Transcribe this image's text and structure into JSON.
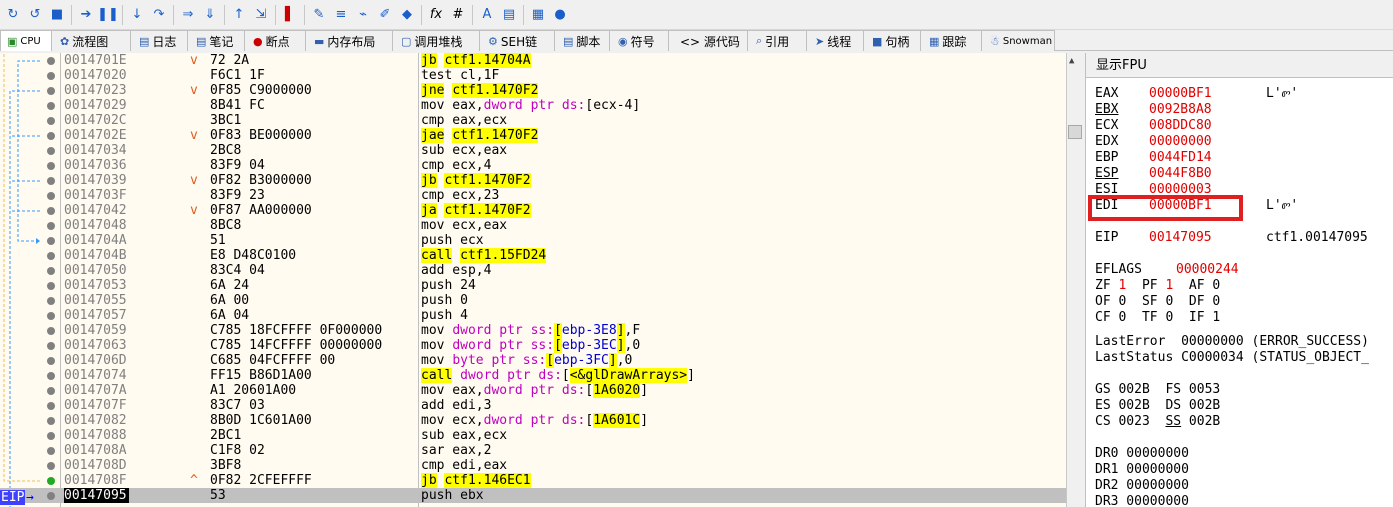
{
  "toolbar": {
    "icons": [
      "open-icon",
      "restart-icon",
      "stop-icon",
      "run-icon",
      "pause-icon",
      "step-into-icon",
      "step-over-icon",
      "trace-into-icon",
      "trace-over-icon",
      "execute-till-return-icon",
      "run-to-user-code-icon",
      "breakpoint-icon",
      "patch-icon",
      "comment-icon",
      "label-icon",
      "bookmark-icon",
      "highlight-icon",
      "fx-icon",
      "hash-icon",
      "font-icon",
      "dump-icon",
      "calculator-icon",
      "globe-icon"
    ]
  },
  "tabs": [
    {
      "label": "CPU",
      "icon": "cpu-icon"
    },
    {
      "label": "流程图",
      "icon": "graph-icon"
    },
    {
      "label": "日志",
      "icon": "log-icon"
    },
    {
      "label": "笔记",
      "icon": "notes-icon"
    },
    {
      "label": "断点",
      "icon": "breakpoint-dot-icon"
    },
    {
      "label": "内存布局",
      "icon": "memory-icon"
    },
    {
      "label": "调用堆栈",
      "icon": "callstack-icon"
    },
    {
      "label": "SEH链",
      "icon": "seh-icon"
    },
    {
      "label": "脚本",
      "icon": "script-icon"
    },
    {
      "label": "符号",
      "icon": "symbol-icon"
    },
    {
      "label": "<> 源代码",
      "icon": "source-icon"
    },
    {
      "label": "引用",
      "icon": "search-icon"
    },
    {
      "label": "线程",
      "icon": "thread-icon"
    },
    {
      "label": "句柄",
      "icon": "handle-icon"
    },
    {
      "label": "跟踪",
      "icon": "trace-icon"
    },
    {
      "label": "Snowman",
      "icon": "snowman-icon"
    }
  ],
  "disasm": {
    "rows": [
      {
        "addr": "0014701E",
        "arrow": "v",
        "bytes": "72 2A",
        "asm": "jb ctf1.14704A",
        "kind": "jcc"
      },
      {
        "addr": "00147020",
        "arrow": "",
        "bytes": "F6C1 1F",
        "asm": "test cl,1F",
        "kind": "plain"
      },
      {
        "addr": "00147023",
        "arrow": "v",
        "bytes": "0F85 C9000000",
        "asm": "jne ctf1.1470F2",
        "kind": "jcc"
      },
      {
        "addr": "00147029",
        "arrow": "",
        "bytes": "8B41 FC",
        "asm": "mov eax,dword ptr ds:[ecx-4]",
        "kind": "plain"
      },
      {
        "addr": "0014702C",
        "arrow": "",
        "bytes": "3BC1",
        "asm": "cmp eax,ecx",
        "kind": "plain"
      },
      {
        "addr": "0014702E",
        "arrow": "v",
        "bytes": "0F83 BE000000",
        "asm": "jae ctf1.1470F2",
        "kind": "jcc"
      },
      {
        "addr": "00147034",
        "arrow": "",
        "bytes": "2BC8",
        "asm": "sub ecx,eax",
        "kind": "plain"
      },
      {
        "addr": "00147036",
        "arrow": "",
        "bytes": "83F9 04",
        "asm": "cmp ecx,4",
        "kind": "plain"
      },
      {
        "addr": "00147039",
        "arrow": "v",
        "bytes": "0F82 B3000000",
        "asm": "jb ctf1.1470F2",
        "kind": "jcc"
      },
      {
        "addr": "0014703F",
        "arrow": "",
        "bytes": "83F9 23",
        "asm": "cmp ecx,23",
        "kind": "plain"
      },
      {
        "addr": "00147042",
        "arrow": "v",
        "bytes": "0F87 AA000000",
        "asm": "ja ctf1.1470F2",
        "kind": "jcc"
      },
      {
        "addr": "00147048",
        "arrow": "",
        "bytes": "8BC8",
        "asm": "mov ecx,eax",
        "kind": "plain"
      },
      {
        "addr": "0014704A",
        "arrow": "",
        "bytes": "51",
        "asm": "push ecx",
        "kind": "plain"
      },
      {
        "addr": "0014704B",
        "arrow": "",
        "bytes": "E8 D48C0100",
        "asm": "call ctf1.15FD24",
        "kind": "call"
      },
      {
        "addr": "00147050",
        "arrow": "",
        "bytes": "83C4 04",
        "asm": "add esp,4",
        "kind": "plain"
      },
      {
        "addr": "00147053",
        "arrow": "",
        "bytes": "6A 24",
        "asm": "push 24",
        "kind": "plain"
      },
      {
        "addr": "00147055",
        "arrow": "",
        "bytes": "6A 00",
        "asm": "push 0",
        "kind": "plain"
      },
      {
        "addr": "00147057",
        "arrow": "",
        "bytes": "6A 04",
        "asm": "push 4",
        "kind": "plain"
      },
      {
        "addr": "00147059",
        "arrow": "",
        "bytes": "C785 18FCFFFF 0F000000",
        "asm": "mov dword ptr ss:[ebp-3E8],F",
        "kind": "plain"
      },
      {
        "addr": "00147063",
        "arrow": "",
        "bytes": "C785 14FCFFFF 00000000",
        "asm": "mov dword ptr ss:[ebp-3EC],0",
        "kind": "plain"
      },
      {
        "addr": "0014706D",
        "arrow": "",
        "bytes": "C685 04FCFFFF 00",
        "asm": "mov byte ptr ss:[ebp-3FC],0",
        "kind": "plain"
      },
      {
        "addr": "00147074",
        "arrow": "",
        "bytes": "FF15 B86D1A00",
        "asm": "call dword ptr ds:[<&glDrawArrays>]",
        "kind": "call"
      },
      {
        "addr": "0014707A",
        "arrow": "",
        "bytes": "A1 20601A00",
        "asm": "mov eax,dword ptr ds:[1A6020]",
        "kind": "plain"
      },
      {
        "addr": "0014707F",
        "arrow": "",
        "bytes": "83C7 03",
        "asm": "add edi,3",
        "kind": "plain"
      },
      {
        "addr": "00147082",
        "arrow": "",
        "bytes": "8B0D 1C601A00",
        "asm": "mov ecx,dword ptr ds:[1A601C]",
        "kind": "plain"
      },
      {
        "addr": "00147088",
        "arrow": "",
        "bytes": "2BC1",
        "asm": "sub eax,ecx",
        "kind": "plain"
      },
      {
        "addr": "0014708A",
        "arrow": "",
        "bytes": "C1F8 02",
        "asm": "sar eax,2",
        "kind": "plain"
      },
      {
        "addr": "0014708D",
        "arrow": "",
        "bytes": "3BF8",
        "asm": "cmp edi,eax",
        "kind": "plain"
      },
      {
        "addr": "0014708F",
        "arrow": "^",
        "bytes": "0F82 2CFEFFFF",
        "asm": "jb ctf1.146EC1",
        "kind": "jcc"
      },
      {
        "addr": "00147095",
        "arrow": "",
        "bytes": "53",
        "asm": "push ebx",
        "kind": "plain",
        "eip": true
      }
    ],
    "eip_label": "EIP"
  },
  "registers": {
    "header": "显示FPU",
    "gp": [
      {
        "name": "EAX",
        "value": "00000BF1",
        "note": "L'ꮫ'"
      },
      {
        "name": "EBX",
        "value": "0092B8A8",
        "note": ""
      },
      {
        "name": "ECX",
        "value": "008DDC80",
        "note": ""
      },
      {
        "name": "EDX",
        "value": "00000000",
        "note": ""
      },
      {
        "name": "EBP",
        "value": "0044FD14",
        "note": ""
      },
      {
        "name": "ESP",
        "value": "0044F8B0",
        "note": ""
      },
      {
        "name": "ESI",
        "value": "00000003",
        "note": ""
      },
      {
        "name": "EDI",
        "value": "00000BF1",
        "note": "L'ꮫ'"
      }
    ],
    "eip": {
      "name": "EIP",
      "value": "00147095",
      "note": "ctf1.00147095"
    },
    "eflags": {
      "name": "EFLAGS",
      "value": "00000244"
    },
    "flags_lines": [
      "ZF 1  PF 1  AF 0",
      "OF 0  SF 0  DF 0",
      "CF 0  TF 0  IF 1"
    ],
    "last_error": "LastError  00000000 (ERROR_SUCCESS)",
    "last_status": "LastStatus C0000034 (STATUS_OBJECT_",
    "seg_lines": [
      "GS 002B  FS 0053",
      "ES 002B  DS 002B",
      "CS 0023  SS 002B"
    ],
    "dr_lines": [
      "DR0 00000000",
      "DR1 00000000",
      "DR2 00000000",
      "DR3 00000000"
    ]
  },
  "colors": {
    "highlight": "#ffff00",
    "edi_box": "#e02020",
    "eip_arrow": "#0000ff"
  }
}
